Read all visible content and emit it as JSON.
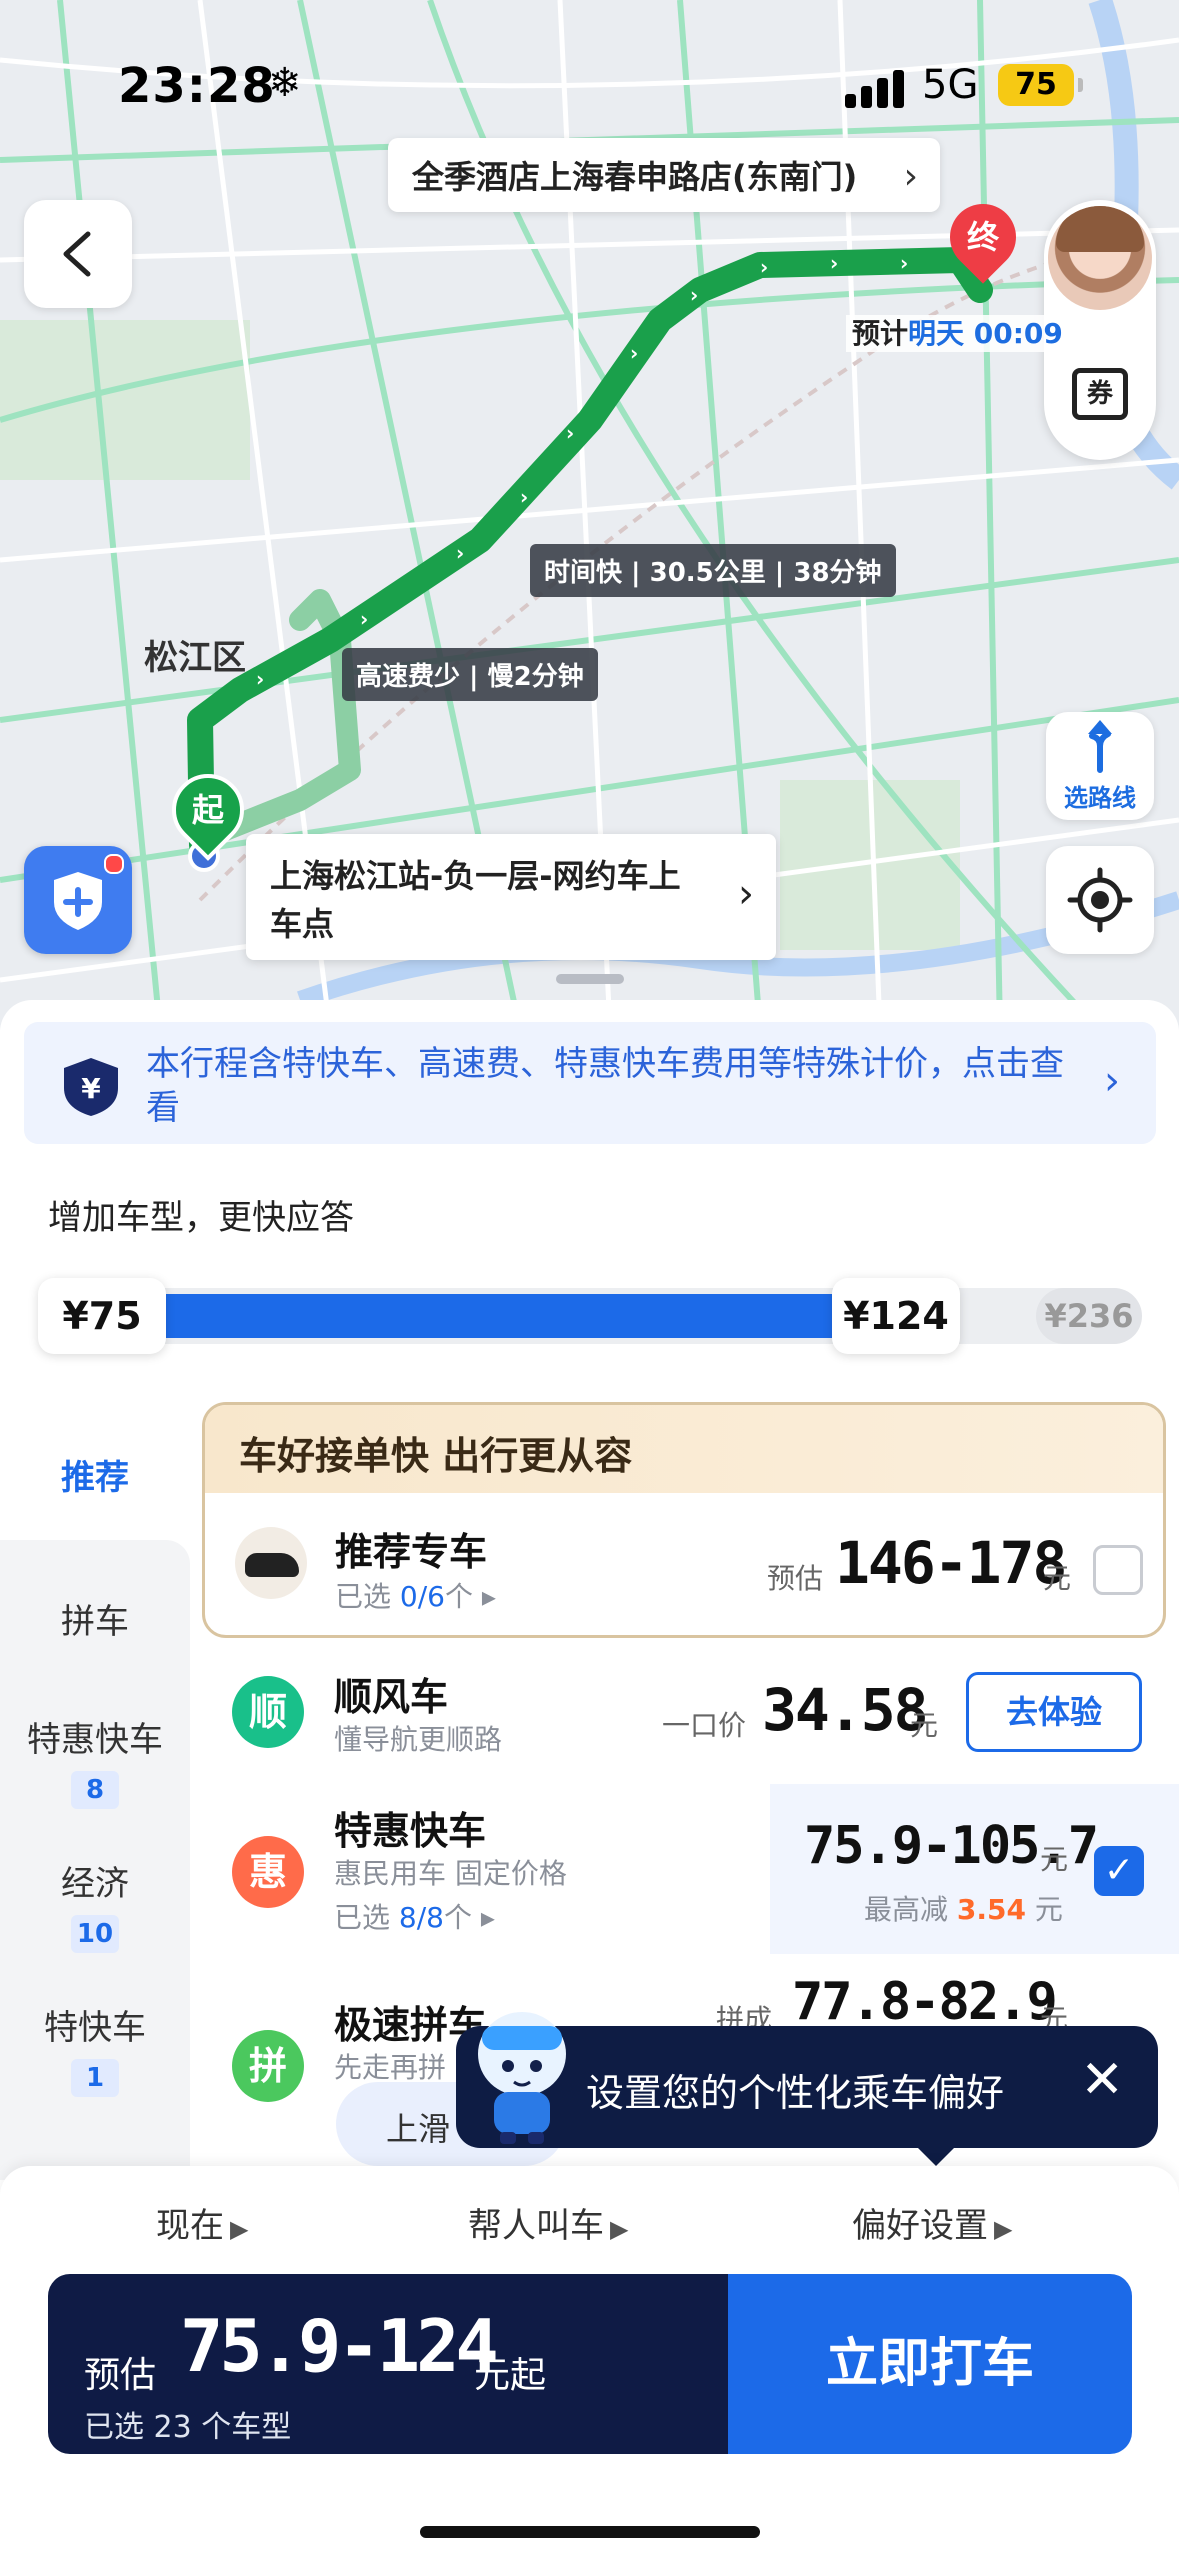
{
  "status_bar": {
    "time": "23:28",
    "weather_icon": "snowflake-icon",
    "network": "5G",
    "battery": "75"
  },
  "map": {
    "destination_label": "全季酒店上海春申路店(东南门)",
    "end_marker": "终",
    "start_marker": "起",
    "eta_prefix": "预计",
    "eta_value": "明天 00:09",
    "route_tag_fast": "时间快 | 30.5公里 | 38分钟",
    "route_tag_toll": "高速费少 | 慢2分钟",
    "district": "松江区",
    "pickup_point": "上海松江站-负一层-网约车上车点",
    "route_select_label": "选路线",
    "coupon_label": "券",
    "colors": {
      "route": "#1aa04b",
      "route_alt": "#8ccfa4",
      "road": "#ffffff",
      "green_road": "#9ee3c0"
    }
  },
  "notice": {
    "text": "本行程含特快车、高速费、特惠快车费用等特殊计价，点击查看"
  },
  "add_type_hint": "增加车型，更快应答",
  "price_slider": {
    "min": "¥75",
    "selected": "¥124",
    "max": "¥236",
    "fill_fraction": 0.28
  },
  "categories": [
    {
      "label": "推荐",
      "count": "",
      "active": true
    },
    {
      "label": "拼车",
      "count": "",
      "active": false
    },
    {
      "label": "特惠快车",
      "count": "8",
      "active": false
    },
    {
      "label": "经济",
      "count": "10",
      "active": false
    },
    {
      "label": "特快车",
      "count": "1",
      "active": false
    }
  ],
  "recommend_card": {
    "header": "车好接单快 出行更从容",
    "name": "推荐专车",
    "sub_prefix": "已选",
    "sub_count": "0/6",
    "sub_suffix": "个",
    "price_label": "预估",
    "price": "146-178",
    "unit": "元",
    "checked": false
  },
  "rides": [
    {
      "icon_char": "顺",
      "icon_color": "#19c08a",
      "name": "顺风车",
      "sub": "懂导航更顺路",
      "price_label": "一口价",
      "price": "34.58",
      "unit": "元",
      "action": "去体验"
    },
    {
      "icon_char": "惠",
      "icon_color": "#ff6b4a",
      "name": "特惠快车",
      "sub": "惠民用车 固定价格",
      "sub2_prefix": "已选",
      "sub2_count": "8/8",
      "sub2_suffix": "个",
      "price": "75.9-105.7",
      "unit": "元",
      "discount_label": "最高减",
      "discount_value": "3.54",
      "discount_unit": "元",
      "checked": true
    },
    {
      "icon_char": "拼",
      "icon_color": "#4bc85e",
      "name": "极速拼车",
      "sub": "先走再拼",
      "price_label": "拼成",
      "price": "77.8-82.9",
      "unit": "元"
    }
  ],
  "swipe_hint": "上滑",
  "tooltip": "设置您的个性化乘车偏好",
  "bottom_options": [
    "现在",
    "帮人叫车",
    "偏好设置"
  ],
  "cta": {
    "pre": "预估",
    "amount": "75.9-124",
    "suffix": "元起",
    "selected": "已选 23 个车型",
    "button": "立即打车"
  }
}
